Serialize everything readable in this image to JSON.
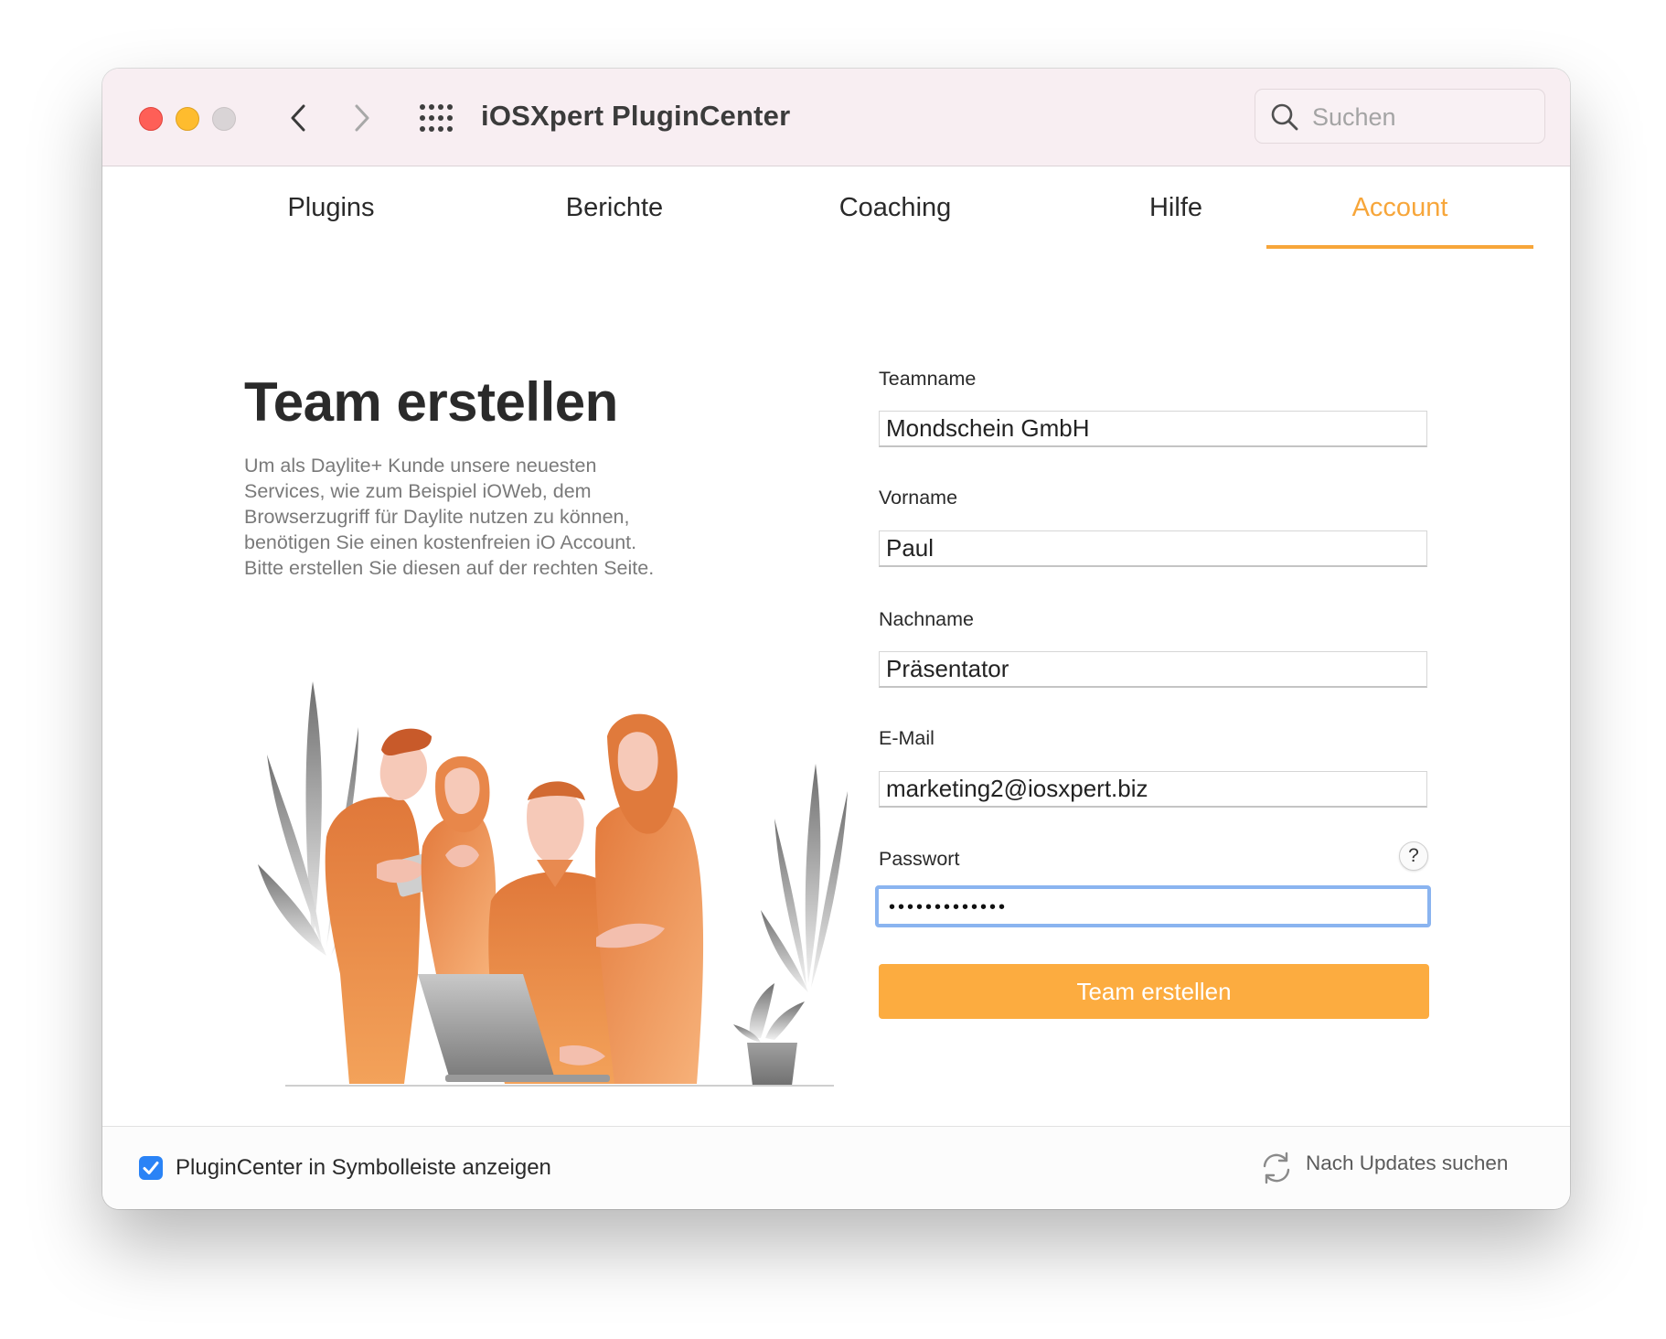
{
  "window": {
    "title": "iOSXpert PluginCenter"
  },
  "search": {
    "placeholder": "Suchen"
  },
  "tabs": [
    {
      "label": "Plugins",
      "active": false
    },
    {
      "label": "Berichte",
      "active": false
    },
    {
      "label": "Coaching",
      "active": false
    },
    {
      "label": "Hilfe",
      "active": false
    },
    {
      "label": "Account",
      "active": true
    }
  ],
  "main": {
    "heading": "Team erstellen",
    "description": "Um als Daylite+ Kunde unsere neuesten\nServices, wie zum Beispiel iOWeb, dem\nBrowserzugriff für Daylite nutzen zu können,\nbenötigen Sie einen kostenfreien iO Account.\nBitte erstellen Sie diesen auf der rechten Seite."
  },
  "form": {
    "teamname": {
      "label": "Teamname",
      "value": "Mondschein GmbH"
    },
    "vorname": {
      "label": "Vorname",
      "value": "Paul"
    },
    "nachname": {
      "label": "Nachname",
      "value": "Präsentator"
    },
    "email": {
      "label": "E-Mail",
      "value": "marketing2@iosxpert.biz"
    },
    "passwort": {
      "label": "Passwort",
      "masked": "•••••••••••••",
      "help": "?"
    },
    "submit_label": "Team erstellen"
  },
  "footer": {
    "show_in_toolbar": {
      "label": "PluginCenter in Symbolleiste anzeigen",
      "checked": true
    },
    "updates_label": "Nach Updates suchen"
  },
  "colors": {
    "accent": "#f7a63a",
    "button": "#fcac40",
    "focus_ring": "#8ab4f0",
    "checkbox": "#2a83f6",
    "titlebar": "#f8eef2"
  },
  "icons": [
    "close-dot",
    "minimize-dot",
    "zoom-dot",
    "chevron-left-icon",
    "chevron-right-icon",
    "grid-icon",
    "search-icon",
    "help-icon",
    "checkmark-icon",
    "refresh-icon"
  ]
}
